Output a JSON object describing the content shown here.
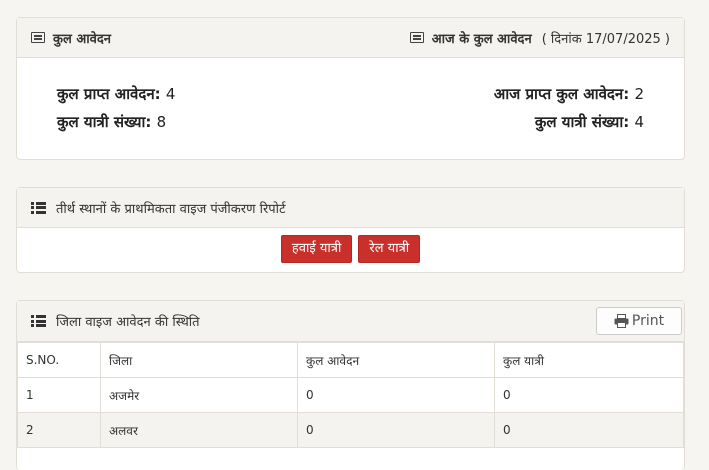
{
  "summary": {
    "left_title": "कुल आवेदन",
    "right_title": "आज के कुल आवेदन",
    "right_date": "( दिनांक 17/07/2025 )",
    "left": {
      "received_label": "कुल प्राप्त आवेदन:",
      "received_value": "4",
      "pilgrims_label": "कुल यात्री संख्या:",
      "pilgrims_value": "8"
    },
    "right": {
      "received_label": "आज प्राप्त कुल आवेदन:",
      "received_value": "2",
      "pilgrims_label": "कुल यात्री संख्या:",
      "pilgrims_value": "4"
    }
  },
  "priority": {
    "title": "तीर्थ स्थानों के प्राथमिकता वाइज पंजीकरण रिपोर्ट",
    "air_button": "हवाई यात्री",
    "rail_button": "रेल यात्री"
  },
  "district": {
    "title": "जिला वाइज आवेदन की स्थिति",
    "print_label": "Print",
    "columns": [
      "S.NO.",
      "जिला",
      "कुल आवेदन",
      "कुल यात्री"
    ],
    "rows": [
      [
        "1",
        "अजमेर",
        "0",
        "0"
      ],
      [
        "2",
        "अलवर",
        "0",
        "0"
      ]
    ]
  }
}
